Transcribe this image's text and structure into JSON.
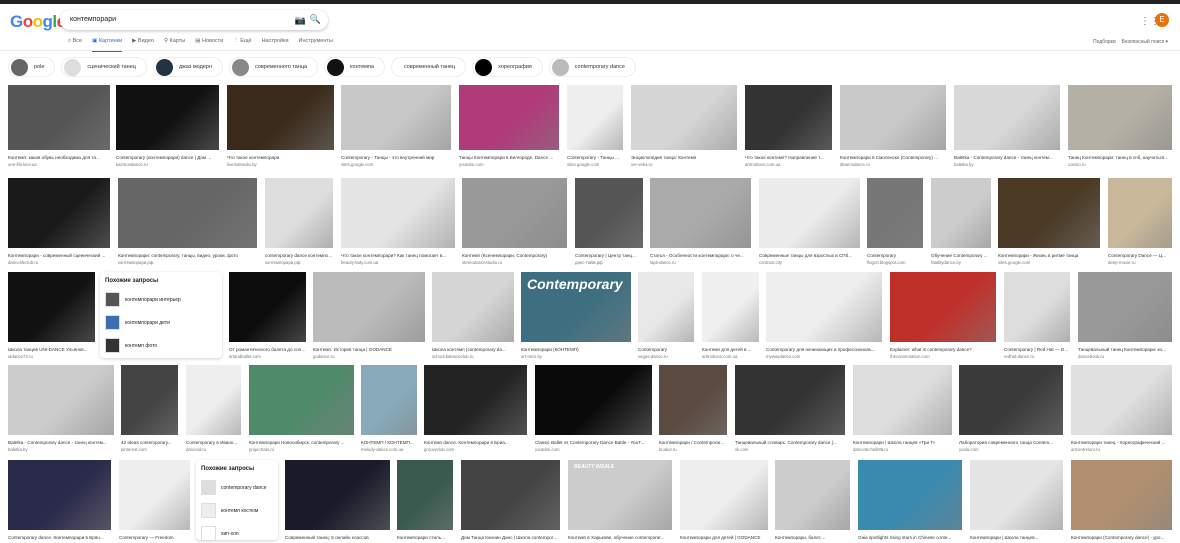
{
  "header": {
    "logo": "Google",
    "query": "контемпорари",
    "avatar_letter": "E"
  },
  "tabs": [
    {
      "label": "Все",
      "icon": "search-icon"
    },
    {
      "label": "Картинки",
      "icon": "image-icon",
      "active": true
    },
    {
      "label": "Видео",
      "icon": "video-icon"
    },
    {
      "label": "Карты",
      "icon": "map-pin-icon"
    },
    {
      "label": "Новости",
      "icon": "news-icon"
    },
    {
      "label": "Ещё",
      "icon": "more-icon"
    },
    {
      "label": "Настройки"
    },
    {
      "label": "Инструменты"
    }
  ],
  "right_tools": {
    "collections": "Подборки",
    "safe_search": "Безопасный поиск ▾"
  },
  "chips": [
    {
      "label": "pole",
      "bg": "#666"
    },
    {
      "label": "сценический танец",
      "bg": "#ddd"
    },
    {
      "label": "джаз модерн",
      "bg": "#234"
    },
    {
      "label": "современного танца",
      "bg": "#888"
    },
    {
      "label": "контемпа",
      "bg": "#111"
    },
    {
      "label": "современный танец"
    },
    {
      "label": "хореография",
      "bg": "#000"
    },
    {
      "label": "contemporary dance",
      "bg": "#bbb"
    }
  ],
  "rows": [
    [
      {
        "caption": "Контемп: какая обувь необходима для та...",
        "source": "one-life.kiev.ua",
        "bg": "#555"
      },
      {
        "caption": "Contemporary (контемпорари) dance | Дом ...",
        "source": "kazmondance.ru",
        "bg": "#111"
      },
      {
        "caption": "Что такое контемпорари",
        "source": "livertalstudio.by",
        "bg": "#3a2a1a"
      },
      {
        "caption": "Contemporary - Танцы - это внутренний мир",
        "source": "sites.google.com",
        "bg": "#c8c8c8"
      },
      {
        "caption": "Танцы Контемпорари в Белгороде. Dance ...",
        "source": "youtube.com",
        "bg": "#b03a7a"
      },
      {
        "caption": "Contemporary - Танцы ...",
        "source": "sites.google.com",
        "bg": "#eeeeee"
      },
      {
        "caption": "Энциклопедия танца: Контемп",
        "source": "ver-veka.ru",
        "bg": "#d6d6d6"
      },
      {
        "caption": "Что такое контемп? Направление т...",
        "source": "artmotions.com.ua",
        "bg": "#333"
      },
      {
        "caption": "Контемпорари в Смоленске (Contemporary) ...",
        "source": "dkaerodance.ru",
        "bg": "#c9c9c9"
      },
      {
        "caption": "Baletka - Contemporary dance - танец контем...",
        "source": "baletka.by",
        "bg": "#d8d8d8"
      },
      {
        "caption": "Танец Контемпорари: танец в спб, научиться...",
        "source": "cosmo.ru",
        "bg": "#b5b0a5"
      }
    ],
    [
      {
        "caption": "Контемпорари - современный сценический ...",
        "source": "dancelifeclub.ru",
        "bg": "#1a1a1a"
      },
      {
        "caption": "Контемпорари: contemporary, танцы, видео, уроки, фото",
        "source": "контемпорари.рф",
        "bg": "#666"
      },
      {
        "caption": "contemporary dance контемпорари",
        "source": "контемпорари.рф",
        "bg": "#ddd"
      },
      {
        "caption": "Что такое контемпорари? Как танец помогает в...",
        "source": "beauty-lady.com.ua",
        "bg": "#e5e5e5"
      },
      {
        "caption": "Контемп (Ксенемпорари, Contemporary)",
        "source": "stereodancestudio.ru",
        "bg": "#999"
      },
      {
        "caption": "Contemporary | Центр танц...",
        "source": "данс-тайм.рф",
        "bg": "#555"
      },
      {
        "caption": "Статья - Особенности контемпорари: о че...",
        "source": "lapli-dance.ru",
        "bg": "#aaa"
      },
      {
        "caption": "Современные танцы для взрослых в СПб...",
        "source": "contrast.city",
        "bg": "#ececec"
      },
      {
        "caption": "Contemporary",
        "source": "flogcrt.blogspot.com",
        "bg": "#777"
      },
      {
        "caption": "Обучение Contemporary ...",
        "source": "fatalitydance.by",
        "bg": "#ccc"
      },
      {
        "caption": "Контемпорари - Жизнь в ритме танца",
        "source": "sites.google.com",
        "bg": "#4a3a25"
      },
      {
        "caption": "Contemporary Dance — Ц...",
        "source": "deep-movie.ru",
        "bg": "#c9b89a"
      }
    ],
    [
      {
        "caption": "Школа танцев UNI-DANCE Ульянов...",
        "source": "uldance72.ru",
        "bg": "#111"
      },
      {
        "caption": "От романтического балета до contemporary...",
        "source": "artandballet.com",
        "bg": "#0d0d0d"
      },
      {
        "caption": "Контемп. История танца | GODANCE",
        "source": "godance.ru",
        "bg": "#bbb"
      },
      {
        "caption": "Школа контемп (contemporary da...",
        "source": "school.balanceclub.ru",
        "bg": "#d5d5d5"
      },
      {
        "caption": "Контемпорари (КОНТЕМП)",
        "source": "art-retro.by",
        "bg": "#3d6f80",
        "overlay": "Contemporary"
      },
      {
        "caption": "Contemporary",
        "source": "vegas-dance.ru",
        "bg": "#e8e8e8"
      },
      {
        "caption": "Контемп для детей в ...",
        "source": "artmotions.com.ua",
        "bg": "#f0f0f0"
      },
      {
        "caption": "Contemporary для начинающих и профессиональ...",
        "source": "mywaydance.com",
        "bg": "#eee"
      },
      {
        "caption": "Explainer: what is contemporary dance?",
        "source": "theconversation.com",
        "bg": "#c0302a"
      },
      {
        "caption": "Contemporary | Red Hat — Dance...",
        "source": "redhat-dance.ru",
        "bg": "#ddd"
      },
      {
        "caption": "Танцевальный танец Контемпорари: ко...",
        "source": "dancebook.ru",
        "bg": "#999"
      }
    ],
    [
      {
        "caption": "Baletka - Contemporary dance - танец контем...",
        "source": "baletka.by",
        "bg": "#ccc"
      },
      {
        "caption": "42 Ideas contemporary...",
        "source": "pinterest.com",
        "bg": "#444"
      },
      {
        "caption": "Contemporary в Ивано...",
        "source": "danceid.ru",
        "bg": "#eee"
      },
      {
        "caption": "Контемпорари Новосибирск. contemporary ...",
        "source": "projectrain.ru",
        "bg": "#4f8a6a"
      },
      {
        "caption": "КОНТЕМП / КОНТЕМП...",
        "source": "melody-dance.com.ua",
        "bg": "#8ab"
      },
      {
        "caption": "Контемп dance. Контемпорари в Бриа...",
        "source": "groovyclub.com",
        "bg": "#222"
      },
      {
        "caption": "Classic Ballet vs Contemporary Dance Battle - YouT...",
        "source": "youtube.com",
        "bg": "#0a0a0a"
      },
      {
        "caption": "Контемпорари / Contemporar...",
        "source": "bcakor.ru",
        "bg": "#5a4a40"
      },
      {
        "caption": "Танцевальный словарь: Contemporary dance |...",
        "source": "vk.com",
        "bg": "#333"
      },
      {
        "caption": "Контемпорари | Школа танцев «Три Т»",
        "source": "dancetechnik86.ru",
        "bg": "#ddd"
      },
      {
        "caption": "Лаборатория современного танца Contem...",
        "source": "youla.com",
        "bg": "#3a3a3a"
      },
      {
        "caption": "Контемпорари танец - Хореографический ...",
        "source": "artcentrelonr.ru",
        "bg": "#e0e0e0"
      }
    ],
    [
      {
        "caption": "Contemporary dance. Контемпорари в Брян...",
        "source": "",
        "bg": "#2a2a4a"
      },
      {
        "caption": "Contemporary — Freedom",
        "source": "",
        "bg": "#eee"
      },
      {
        "caption": "Современный танец: 5 онлайн классов",
        "source": "",
        "bg": "#1a1a2a"
      },
      {
        "caption": "Контемпорари стиль...",
        "source": "",
        "bg": "#3a5a50"
      },
      {
        "caption": "Дом Танца Каннин Данс | Школа contemporary dance",
        "source": "",
        "bg": "#444"
      },
      {
        "caption": "Контемп в Харькове, обучение contemporar...",
        "source": "",
        "bg": "#ccc",
        "overlay": "BEAUTY INSALE"
      },
      {
        "caption": "Контемпорари для детей | GODANCE",
        "source": "",
        "bg": "#eee"
      },
      {
        "caption": "Контемпорари, балет,...",
        "source": "",
        "bg": "#ccc"
      },
      {
        "caption": "Gaia spotlights rising stars in Chinese conte...",
        "source": "",
        "bg": "#3a8ab0"
      },
      {
        "caption": "Контемпорари | Школа танцев...",
        "source": "",
        "bg": "#e5e5e5"
      },
      {
        "caption": "Контемпорари (Contemporary dance) - уро...",
        "source": "",
        "bg": "#b09070"
      }
    ]
  ],
  "related_1": {
    "title": "Похожие запросы",
    "items": [
      {
        "label": "контемпорари интерьер",
        "bg": "#555"
      },
      {
        "label": "контемпорари дети",
        "bg": "#3b6fb0"
      },
      {
        "label": "контемп фото",
        "bg": "#333"
      }
    ]
  },
  "related_2": {
    "title": "Похожие запросы",
    "items": [
      {
        "label": "contemporary dance",
        "bg": "#ddd"
      },
      {
        "label": "контемп костюм",
        "bg": "#eee"
      },
      {
        "label": "хип-хоп",
        "bg": "#fff"
      }
    ]
  }
}
